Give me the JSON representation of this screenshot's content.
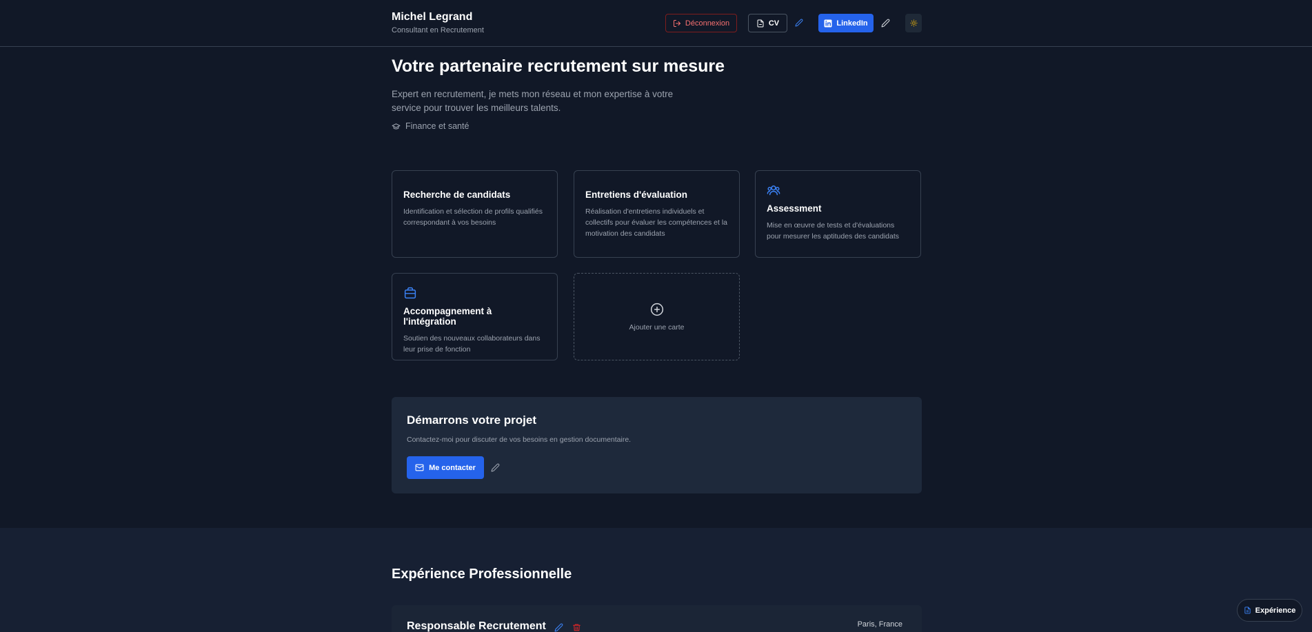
{
  "header": {
    "name": "Michel Legrand",
    "subtitle": "Consultant en Recrutement",
    "logout_label": "Déconnexion",
    "cv_label": "CV",
    "linkedin_label": "LinkedIn"
  },
  "hero": {
    "title": "Votre partenaire recrutement sur mesure",
    "description": "Expert en recrutement, je mets mon réseau et mon expertise à votre service pour trouver les meilleurs talents.",
    "tag": "Finance et santé"
  },
  "cards": [
    {
      "title": "Recherche de candidats",
      "description": "Identification et sélection de profils qualifiés correspondant à vos besoins",
      "icon": null
    },
    {
      "title": "Entretiens d'évaluation",
      "description": "Réalisation d'entretiens individuels et collectifs pour évaluer les compétences et la motivation des candidats",
      "icon": null
    },
    {
      "title": "Assessment",
      "description": "Mise en œuvre de tests et d'évaluations pour mesurer les aptitudes des candidats",
      "icon": "users-icon"
    },
    {
      "title": "Accompagnement à l'intégration",
      "description": "Soutien des nouveaux collaborateurs dans leur prise de fonction",
      "icon": "briefcase-icon"
    }
  ],
  "add_card_label": "Ajouter une carte",
  "cta": {
    "title": "Démarrons votre projet",
    "description": "Contactez-moi pour discuter de vos besoins en gestion documentaire.",
    "button_label": "Me contacter"
  },
  "experience": {
    "section_title": "Expérience Professionnelle",
    "items": [
      {
        "title": "Responsable Recrutement",
        "location": "Paris, France"
      }
    ]
  },
  "floating_button_label": "Expérience",
  "colors": {
    "background": "#111827",
    "accent": "#2563eb",
    "danger": "#f87171",
    "theme_icon": "#eab308"
  }
}
